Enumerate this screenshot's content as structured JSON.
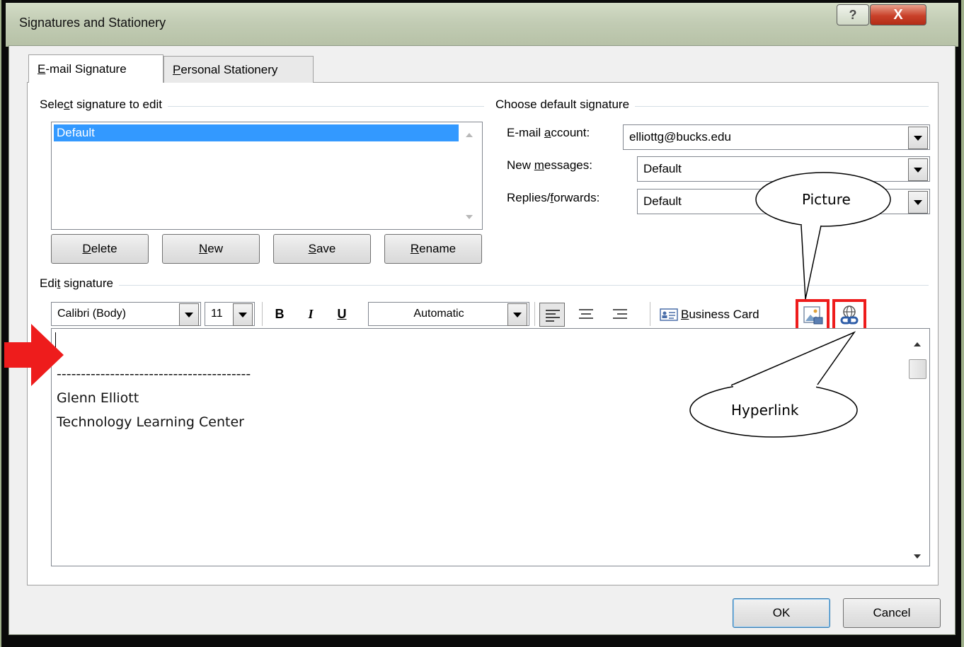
{
  "window": {
    "title": "Signatures and Stationery",
    "help_glyph": "?",
    "close_glyph": "X"
  },
  "tabs": [
    {
      "label": "E-mail Signature",
      "accel": "E",
      "rest": "-mail Signature",
      "active": true
    },
    {
      "label": "Personal Stationery",
      "accel": "P",
      "rest": "ersonal Stationery",
      "active": false
    }
  ],
  "select_group": {
    "label_pre": "Sele",
    "label_accel": "c",
    "label_post": "t signature to edit",
    "signatures": [
      "Default"
    ],
    "buttons": [
      {
        "accel": "D",
        "rest": "elete"
      },
      {
        "accel": "N",
        "rest": "ew"
      },
      {
        "accel": "S",
        "rest": "ave"
      },
      {
        "accel": "R",
        "rest": "ename"
      }
    ]
  },
  "default_group": {
    "label": "Choose default signature",
    "email_account": {
      "pre": "E-mail ",
      "accel": "a",
      "post": "ccount:",
      "value": "elliottg@bucks.edu"
    },
    "new_messages": {
      "pre": "New ",
      "accel": "m",
      "post": "essages:",
      "value": "Default"
    },
    "replies": {
      "pre": "Replies/",
      "accel": "f",
      "post": "orwards:",
      "value": "Default"
    }
  },
  "edit_group": {
    "label_pre": "Edi",
    "label_accel": "t",
    "label_post": " signature"
  },
  "toolbar": {
    "font": "Calibri (Body)",
    "size": "11",
    "bold": "B",
    "italic": "I",
    "underline": "U",
    "color": "Automatic",
    "business_card_accel": "B",
    "business_card_rest": "usiness Card"
  },
  "editor": {
    "lines": [
      "----------------------------------------",
      "Glenn Elliott",
      "Technology Learning Center"
    ]
  },
  "footer": {
    "ok": "OK",
    "cancel": "Cancel"
  },
  "annotations": {
    "picture": "Picture",
    "hyperlink": "Hyperlink",
    "highlight_color": "#ee1c1c"
  }
}
